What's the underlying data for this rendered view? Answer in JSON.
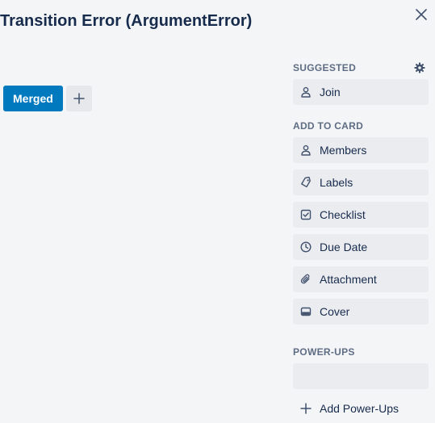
{
  "card": {
    "title": "Transition Error (ArgumentError)"
  },
  "labels": [
    {
      "text": "Merged",
      "color": "#0079bf"
    }
  ],
  "sidebar": {
    "suggested": {
      "heading": "SUGGESTED",
      "items": [
        {
          "label": "Join",
          "icon": "person-icon"
        }
      ]
    },
    "add_to_card": {
      "heading": "ADD TO CARD",
      "items": [
        {
          "label": "Members",
          "icon": "person-icon"
        },
        {
          "label": "Labels",
          "icon": "tag-icon"
        },
        {
          "label": "Checklist",
          "icon": "checkbox-icon"
        },
        {
          "label": "Due Date",
          "icon": "clock-icon"
        },
        {
          "label": "Attachment",
          "icon": "paperclip-icon"
        },
        {
          "label": "Cover",
          "icon": "cover-icon"
        }
      ]
    },
    "power_ups": {
      "heading": "POWER-UPS",
      "add_label": "Add Power-Ups"
    }
  }
}
